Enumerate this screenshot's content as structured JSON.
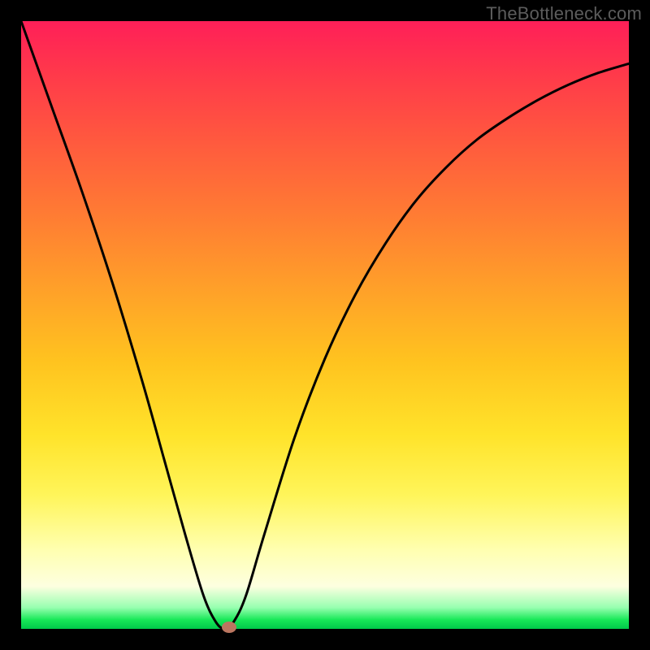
{
  "watermark": "TheBottleneck.com",
  "chart_data": {
    "type": "line",
    "title": "",
    "xlabel": "",
    "ylabel": "",
    "x_range": [
      0,
      1
    ],
    "y_range": [
      0,
      1
    ],
    "series": [
      {
        "name": "curve",
        "x": [
          0.0,
          0.05,
          0.1,
          0.15,
          0.2,
          0.235,
          0.27,
          0.3,
          0.32,
          0.335,
          0.35,
          0.37,
          0.4,
          0.45,
          0.5,
          0.55,
          0.6,
          0.65,
          0.7,
          0.75,
          0.8,
          0.85,
          0.9,
          0.95,
          1.0
        ],
        "y": [
          1.0,
          0.86,
          0.72,
          0.57,
          0.405,
          0.28,
          0.155,
          0.055,
          0.012,
          0.0,
          0.012,
          0.055,
          0.155,
          0.315,
          0.445,
          0.55,
          0.635,
          0.705,
          0.76,
          0.805,
          0.84,
          0.87,
          0.895,
          0.915,
          0.93
        ]
      }
    ],
    "marker": {
      "x": 0.342,
      "y": 0.003
    },
    "background_gradient": {
      "stops": [
        {
          "pos": 0.0,
          "color": "#ff1f58"
        },
        {
          "pos": 0.44,
          "color": "#ffa029"
        },
        {
          "pos": 0.78,
          "color": "#fff55a"
        },
        {
          "pos": 0.93,
          "color": "#fdffe0"
        },
        {
          "pos": 1.0,
          "color": "#00c94a"
        }
      ]
    }
  }
}
